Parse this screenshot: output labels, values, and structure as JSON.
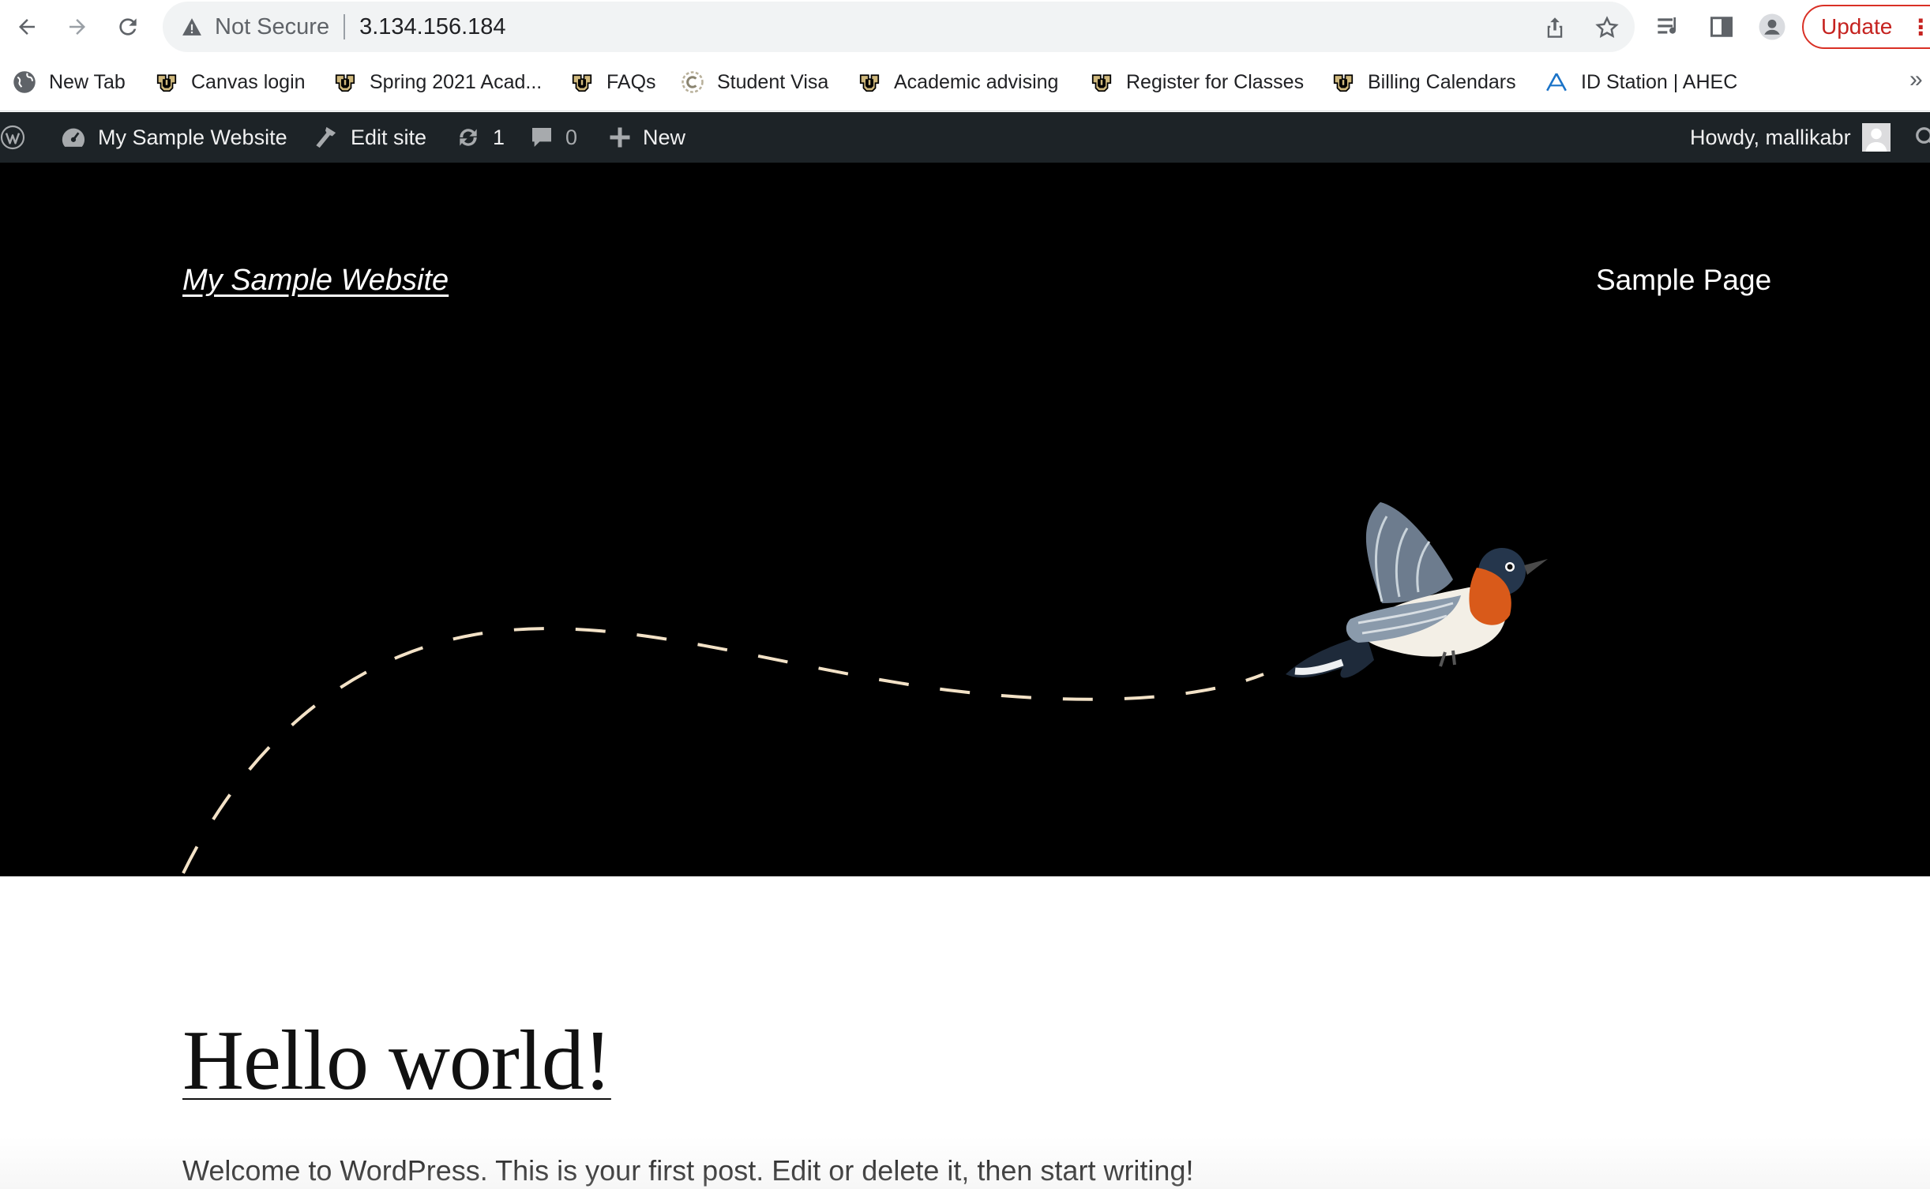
{
  "browser": {
    "security_label": "Not Secure",
    "url": "3.134.156.184",
    "update_label": "Update",
    "more_label": "⋮"
  },
  "bookmarks": {
    "items": [
      {
        "label": "New Tab",
        "icon": "globe-icon"
      },
      {
        "label": "Canvas login",
        "icon": "cu-logo-icon"
      },
      {
        "label": "Spring 2021 Acad...",
        "icon": "cu-logo-icon"
      },
      {
        "label": "FAQs",
        "icon": "cu-logo-icon"
      },
      {
        "label": "Student Visa",
        "icon": "c-logo-icon"
      },
      {
        "label": "Academic advising",
        "icon": "cu-logo-icon"
      },
      {
        "label": "Register for Classes",
        "icon": "cu-logo-icon"
      },
      {
        "label": "Billing Calendars",
        "icon": "cu-logo-icon"
      },
      {
        "label": "ID Station | AHEC",
        "icon": "ahec-logo-icon"
      }
    ],
    "overflow": "»"
  },
  "adminbar": {
    "site_name": "My Sample Website",
    "edit_site": "Edit site",
    "updates_count": "1",
    "comments_count": "0",
    "new_label": "New",
    "howdy": "Howdy, mallikabr"
  },
  "site": {
    "title": "My Sample Website",
    "nav": [
      "Sample Page"
    ]
  },
  "post": {
    "title": "Hello world!",
    "excerpt": "Welcome to WordPress. This is your first post. Edit or delete it, then start writing!"
  },
  "colors": {
    "adminbar_bg": "#1d2327",
    "hero_bg": "#000000",
    "update_red": "#d93025",
    "dash_color": "#f3e2c7"
  }
}
